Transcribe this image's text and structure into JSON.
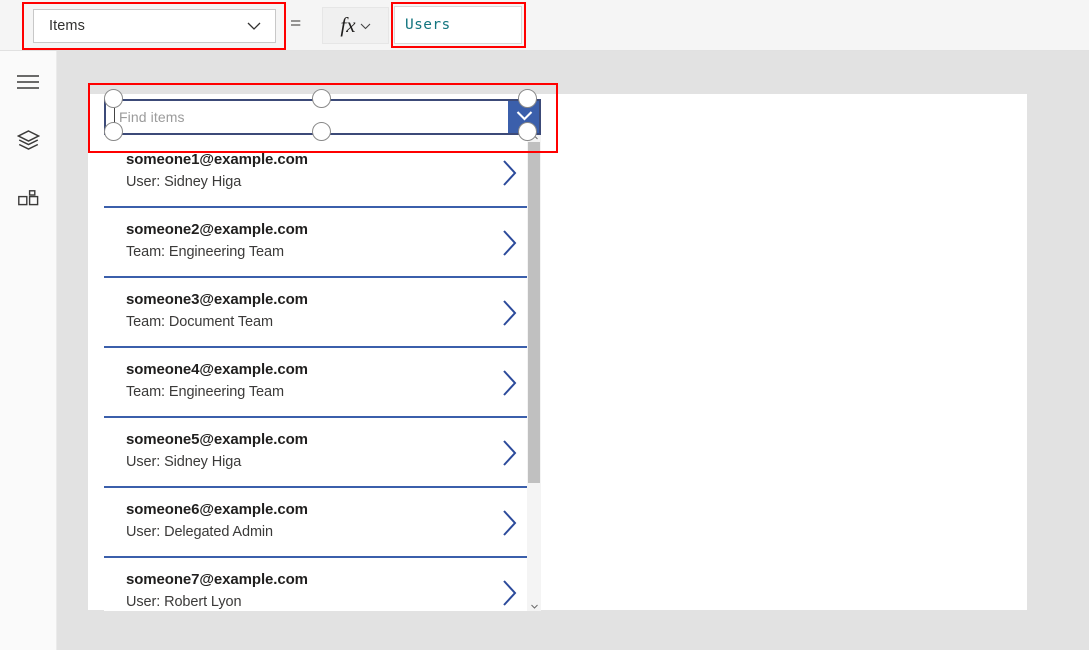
{
  "formula_bar": {
    "property_select": {
      "value": "Items",
      "icon": "chevron-down-icon"
    },
    "equals_sign": "=",
    "fx_button": {
      "label": "fx",
      "icon": "chevron-down-icon"
    },
    "formula_input": {
      "value": "Users"
    }
  },
  "left_rail": {
    "items": [
      {
        "name": "menu-icon",
        "tooltip": "Menu"
      },
      {
        "name": "layers-icon",
        "tooltip": "Tree view"
      },
      {
        "name": "components-icon",
        "tooltip": "Insert"
      }
    ]
  },
  "combobox": {
    "placeholder": "Find items",
    "value": "",
    "toggle_icon": "chevron-down-icon",
    "toggle_color": "#3b5fab"
  },
  "results": {
    "chevron_icon": "chevron-right-icon",
    "divider_color": "#3b5fab",
    "rows": [
      {
        "primary": "someone1@example.com",
        "secondary": "User: Sidney Higa"
      },
      {
        "primary": "someone2@example.com",
        "secondary": "Team: Engineering Team"
      },
      {
        "primary": "someone3@example.com",
        "secondary": "Team: Document Team"
      },
      {
        "primary": "someone4@example.com",
        "secondary": "Team: Engineering Team"
      },
      {
        "primary": "someone5@example.com",
        "secondary": "User: Sidney Higa"
      },
      {
        "primary": "someone6@example.com",
        "secondary": "User: Delegated Admin"
      },
      {
        "primary": "someone7@example.com",
        "secondary": "User: Robert Lyon"
      }
    ]
  },
  "scrollbar": {
    "up_icon": "caret-up-icon",
    "down_icon": "caret-down-icon"
  },
  "annotations": {
    "color": "#ff0000",
    "boxes": [
      {
        "name": "property-select-highlight"
      },
      {
        "name": "formula-input-highlight"
      },
      {
        "name": "combobox-highlight"
      }
    ]
  },
  "selection": {
    "border_color": "#3c4a78",
    "handles": [
      "nw",
      "n",
      "ne",
      "w",
      "e",
      "sw",
      "s",
      "se"
    ]
  }
}
